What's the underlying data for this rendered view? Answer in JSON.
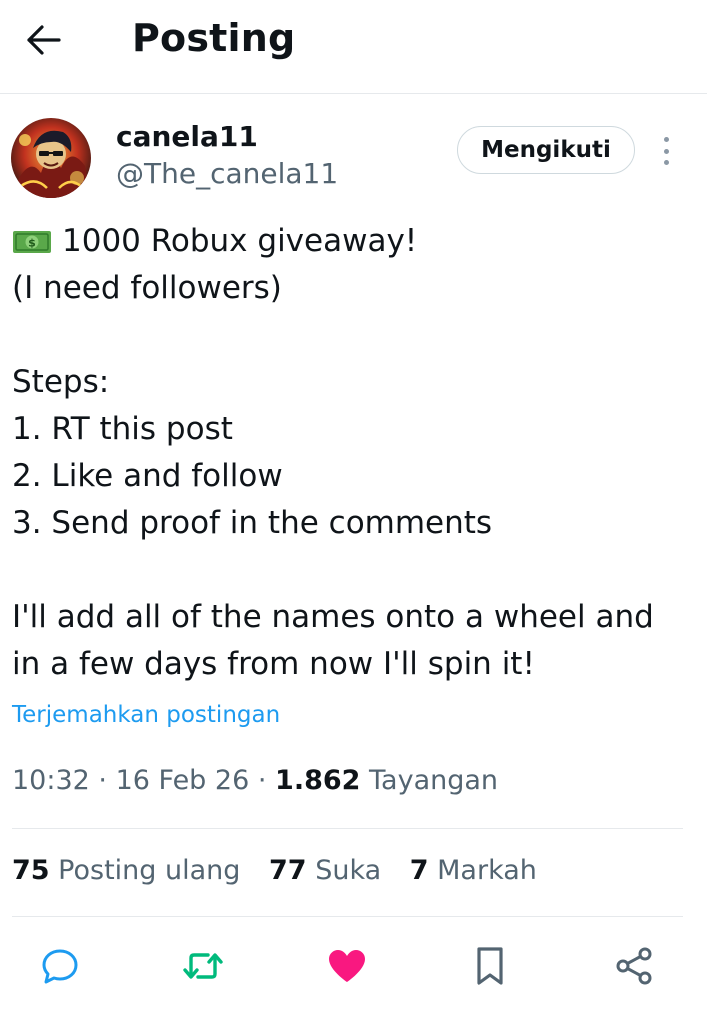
{
  "header": {
    "title": "Posting",
    "back_icon": "arrow-left-icon"
  },
  "author": {
    "display_name": "canela11",
    "handle": "@The_canela11",
    "follow_label": "Mengikuti",
    "more_icon": "more-vertical-icon"
  },
  "tweet": {
    "emoji_icon": "dollar-banknote-icon",
    "line1": "1000 Robux giveaway!",
    "line2": "(I need followers)",
    "line3": "Steps:",
    "line4": "1. RT this post",
    "line5": "2. Like and follow",
    "line6": "3. Send proof in the comments",
    "line7": "I'll add all of the names onto a wheel and",
    "line8": "in a few days from now I'll spin it!"
  },
  "translate_label": "Terjemahkan postingan",
  "meta": {
    "time": "10:32",
    "date": "16 Feb 26",
    "views_count": "1.862",
    "views_label": "Tayangan"
  },
  "stats": {
    "reposts_count": "75",
    "reposts_label": "Posting ulang",
    "likes_count": "77",
    "likes_label": "Suka",
    "bookmarks_count": "7",
    "bookmarks_label": "Markah"
  },
  "actions": [
    "reply-icon",
    "repost-icon",
    "like-icon",
    "bookmark-icon",
    "share-icon"
  ],
  "colors": {
    "accent": "#1d9bf0",
    "repost_active": "#00ba7c",
    "like_active": "#f91880",
    "text_primary": "#0f1419",
    "text_secondary": "#536471",
    "divider": "#e6e9ec"
  }
}
